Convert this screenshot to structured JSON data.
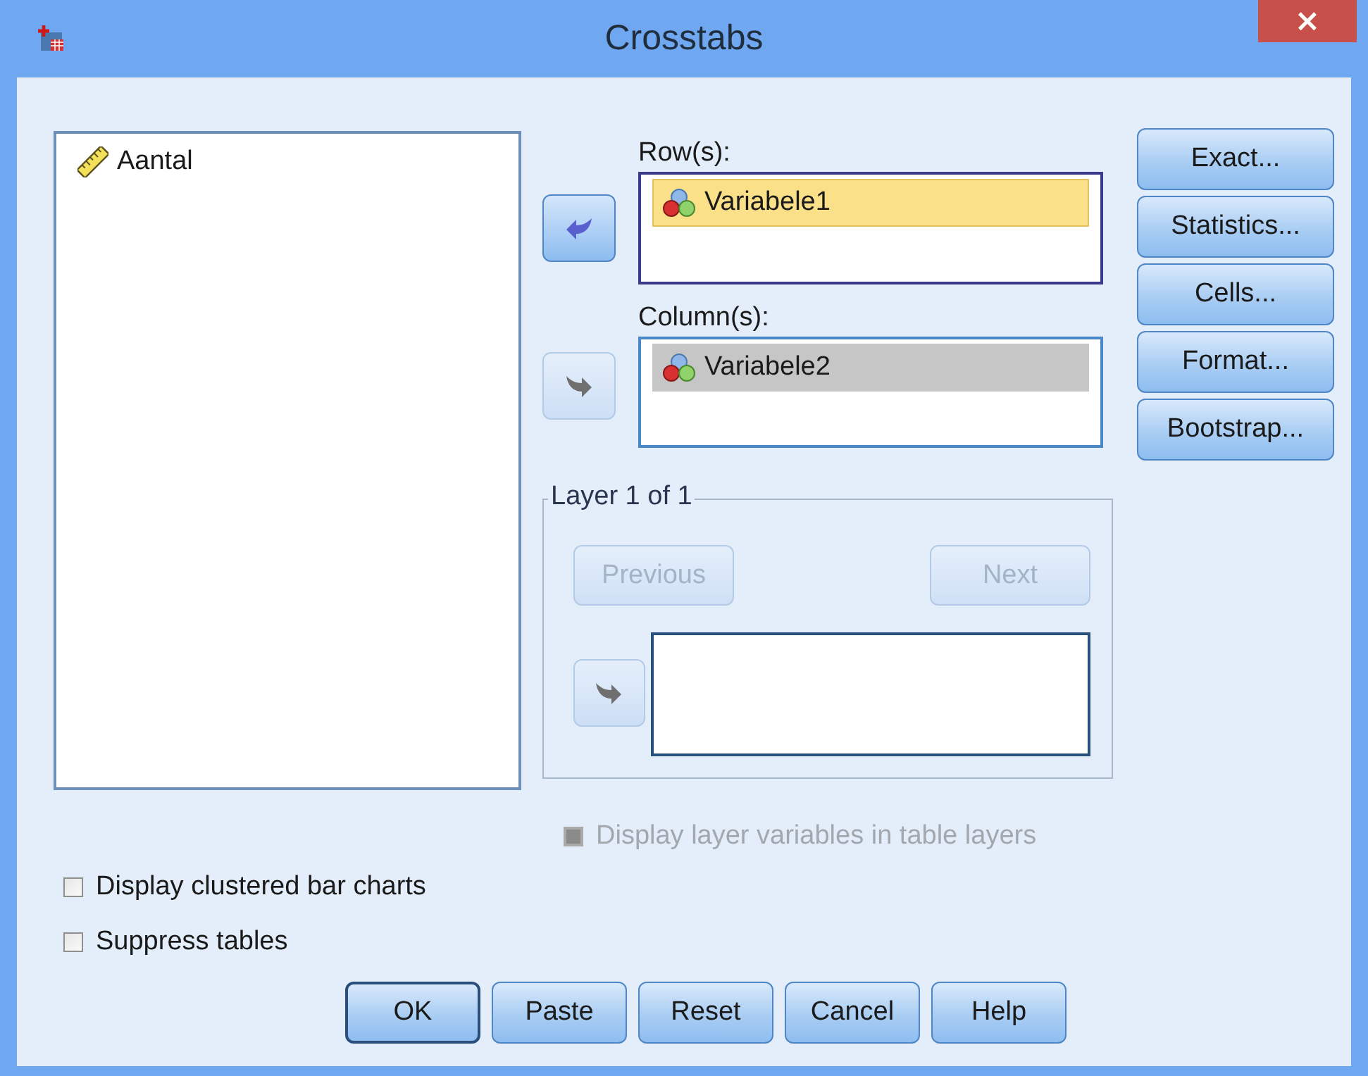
{
  "window": {
    "title": "Crosstabs",
    "close_label": "×"
  },
  "source_list": {
    "items": [
      {
        "name": "Aantal",
        "kind": "scale",
        "selected": false
      }
    ]
  },
  "rows": {
    "label": "Row(s):",
    "arrow": {
      "kind": "left",
      "disabled": false
    },
    "items": [
      {
        "name": "Variabele1",
        "kind": "nominal",
        "selected": true,
        "focused": true
      }
    ]
  },
  "columns": {
    "label": "Column(s):",
    "arrow": {
      "kind": "right",
      "disabled": true
    },
    "items": [
      {
        "name": "Variabele2",
        "kind": "nominal",
        "selected": true,
        "focused": false
      }
    ]
  },
  "layer": {
    "title": "Layer 1 of 1",
    "previous": {
      "label": "Previous",
      "disabled": true
    },
    "next": {
      "label": "Next",
      "disabled": true
    },
    "arrow": {
      "kind": "right",
      "disabled": true
    }
  },
  "layer_option": {
    "label": "Display layer variables in table layers",
    "checked": false,
    "disabled": true
  },
  "side_buttons": [
    {
      "label": "Exact..."
    },
    {
      "label": "Statistics..."
    },
    {
      "label": "Cells..."
    },
    {
      "label": "Format..."
    },
    {
      "label": "Bootstrap..."
    }
  ],
  "options": [
    {
      "label": "Display clustered bar charts",
      "checked": false,
      "disabled": false
    },
    {
      "label": "Suppress tables",
      "checked": false,
      "disabled": false
    }
  ],
  "buttons": [
    {
      "label": "OK",
      "default": true
    },
    {
      "label": "Paste",
      "default": false
    },
    {
      "label": "Reset",
      "default": false
    },
    {
      "label": "Cancel",
      "default": false
    },
    {
      "label": "Help",
      "default": false
    }
  ]
}
